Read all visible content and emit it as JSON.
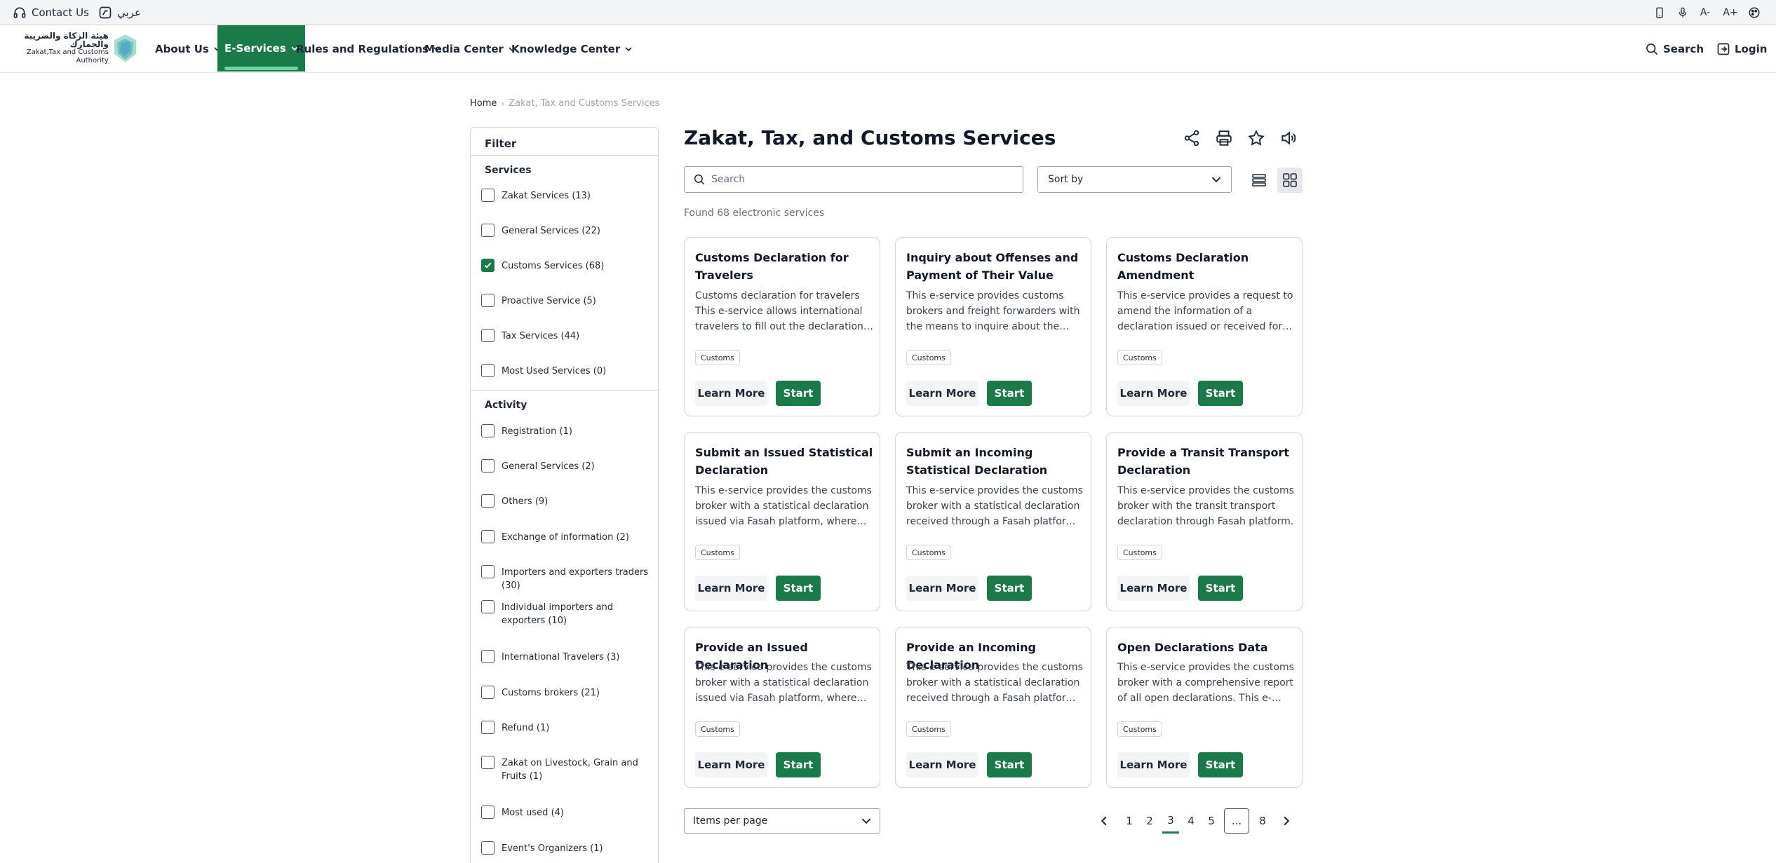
{
  "utilbar": {
    "contact": "Contact Us",
    "lang": "عربي",
    "font_decrease": "A-",
    "font_increase": "A+"
  },
  "logo": {
    "arabic": "هيئة الزكاة والضريبة والجمارك",
    "english": "Zakat,Tax and Customs Authority"
  },
  "nav": {
    "items": [
      "About Us",
      "E-Services",
      "Rules and Regulations",
      "Media Center",
      "Knowledge Center"
    ],
    "search": "Search",
    "login": "Login"
  },
  "breadcrumb": {
    "home": "Home",
    "current": "Zakat, Tax and Customs Services"
  },
  "filter": {
    "title": "Filter",
    "services_heading": "Services",
    "services": [
      {
        "label": "Zakat Services (13)",
        "checked": false
      },
      {
        "label": "General Services (22)",
        "checked": false
      },
      {
        "label": "Customs Services (68)",
        "checked": true
      },
      {
        "label": "Proactive Service (5)",
        "checked": false
      },
      {
        "label": "Tax Services (44)",
        "checked": false
      },
      {
        "label": "Most Used Services (0)",
        "checked": false
      }
    ],
    "activity_heading": "Activity",
    "activity": [
      {
        "label": "Registration (1)"
      },
      {
        "label": "General Services (2)"
      },
      {
        "label": "Others (9)"
      },
      {
        "label": "Exchange of information (2)"
      },
      {
        "label": "Importers and exporters traders (30)"
      },
      {
        "label": "Individual importers and exporters (10)"
      },
      {
        "label": "International Travelers (3)"
      },
      {
        "label": "Customs brokers (21)"
      },
      {
        "label": "Refund (1)"
      },
      {
        "label": "Zakat on Livestock, Grain and Fruits (1)"
      },
      {
        "label": "Most used (4)"
      },
      {
        "label": "Event's Organizers (1)"
      }
    ]
  },
  "main": {
    "title": "Zakat, Tax, and Customs Services",
    "search_placeholder": "Search",
    "sort_label": "Sort by",
    "found": "Found 68 electronic services",
    "learn_label": "Learn More",
    "start_label": "Start",
    "items_per_page": "Items per page"
  },
  "cards": [
    {
      "title": "Customs Declaration for Travelers",
      "desc": "Customs declaration for travelers This e-service allows international travelers to fill out the declaration form",
      "tag": "Customs"
    },
    {
      "title": "Inquiry about Offenses and Payment of Their Value",
      "desc": "This e-service provides customs brokers and freight forwarders with the means to inquire about the offenses",
      "tag": "Customs"
    },
    {
      "title": "Customs Declaration Amendment",
      "desc": "This e-service provides a request to amend the information of a declaration issued or received for the",
      "tag": "Customs"
    },
    {
      "title": "Submit an Issued Statistical Declaration",
      "desc": "This e-service provides the customs broker with a statistical declaration issued via Fasah platform, where the",
      "tag": "Customs"
    },
    {
      "title": "Submit an Incoming Statistical Declaration",
      "desc": "This e-service provides the customs broker with a statistical declaration received through a Fasah platform, and",
      "tag": "Customs"
    },
    {
      "title": "Provide a Transit Transport Declaration",
      "desc": "This e-service provides the customs broker with the transit transport declaration through Fasah platform.",
      "tag": "Customs"
    },
    {
      "title": "Provide an Issued Declaration",
      "desc": "This e-service provides the customs broker with a statistical declaration issued via Fasah platform, where the",
      "tag": "Customs"
    },
    {
      "title": "Provide an Incoming Declaration",
      "desc": "This e-service provides the customs broker with a statistical declaration received through a Fasah platform, and",
      "tag": "Customs"
    },
    {
      "title": "Open Declarations Data",
      "desc": "This e-service provides the customs broker with a comprehensive report of all open declarations. This e-service",
      "tag": "Customs"
    }
  ],
  "pagination": {
    "pages": [
      "1",
      "2",
      "3",
      "4",
      "5",
      "...",
      "8"
    ],
    "current": "3"
  }
}
